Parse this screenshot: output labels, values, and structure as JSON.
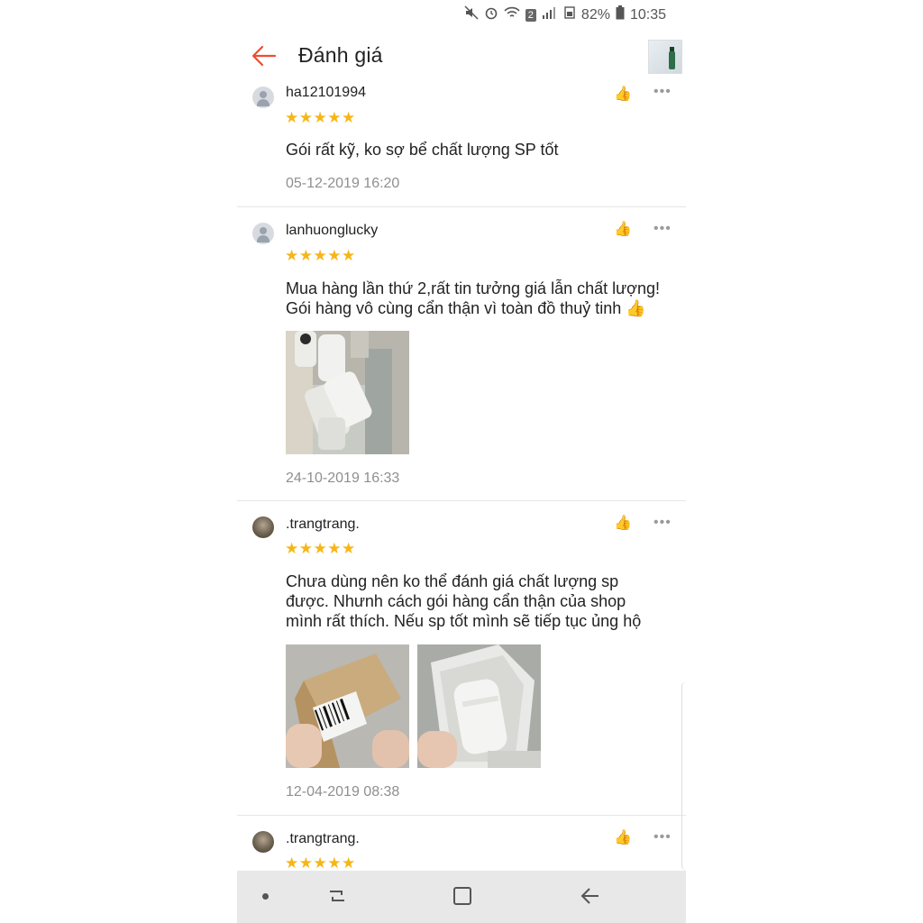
{
  "status_bar": {
    "battery": "82%",
    "time": "10:35",
    "sim_badge": "2",
    "icons": [
      "mute-icon",
      "alarm-icon",
      "wifi-icon",
      "signal-icon",
      "battery-icon"
    ]
  },
  "header": {
    "title": "Đánh giá",
    "back_icon": "arrow-left-icon",
    "accent_color": "#ee4d2d"
  },
  "reviews": [
    {
      "username": "ha12101994",
      "stars": "★★★★★",
      "comment": "Gói rất kỹ, ko sợ bể chất lượng SP tốt",
      "date": "05-12-2019 16:20"
    },
    {
      "username": "lanhuonglucky",
      "stars": "★★★★★",
      "comment_line1": "Mua hàng lần thứ 2,rất tin tưởng giá lẫn chất lượng!",
      "comment_line2": "Gói hàng vô cùng cẩn thận vì toàn đồ thuỷ tinh 👍",
      "date": "24-10-2019 16:33"
    },
    {
      "username": ".trangtrang.",
      "stars": "★★★★★",
      "comment_line1": "Chưa dùng nên ko thể đánh giá chất lượng sp",
      "comment_line2": "được. Nhưnh cách gói hàng cẩn thận của shop",
      "comment_line3": "mình rất thích. Nếu sp tốt mình sẽ tiếp tục ủng hộ",
      "date": "12-04-2019 08:38"
    },
    {
      "username": ".trangtrang.",
      "stars": "★★★★★"
    }
  ],
  "labels": {
    "like": "👍",
    "more": "•••"
  },
  "colors": {
    "star": "#f6b617",
    "date": "#8f8f8f",
    "navbar": "#e8e8e8"
  }
}
